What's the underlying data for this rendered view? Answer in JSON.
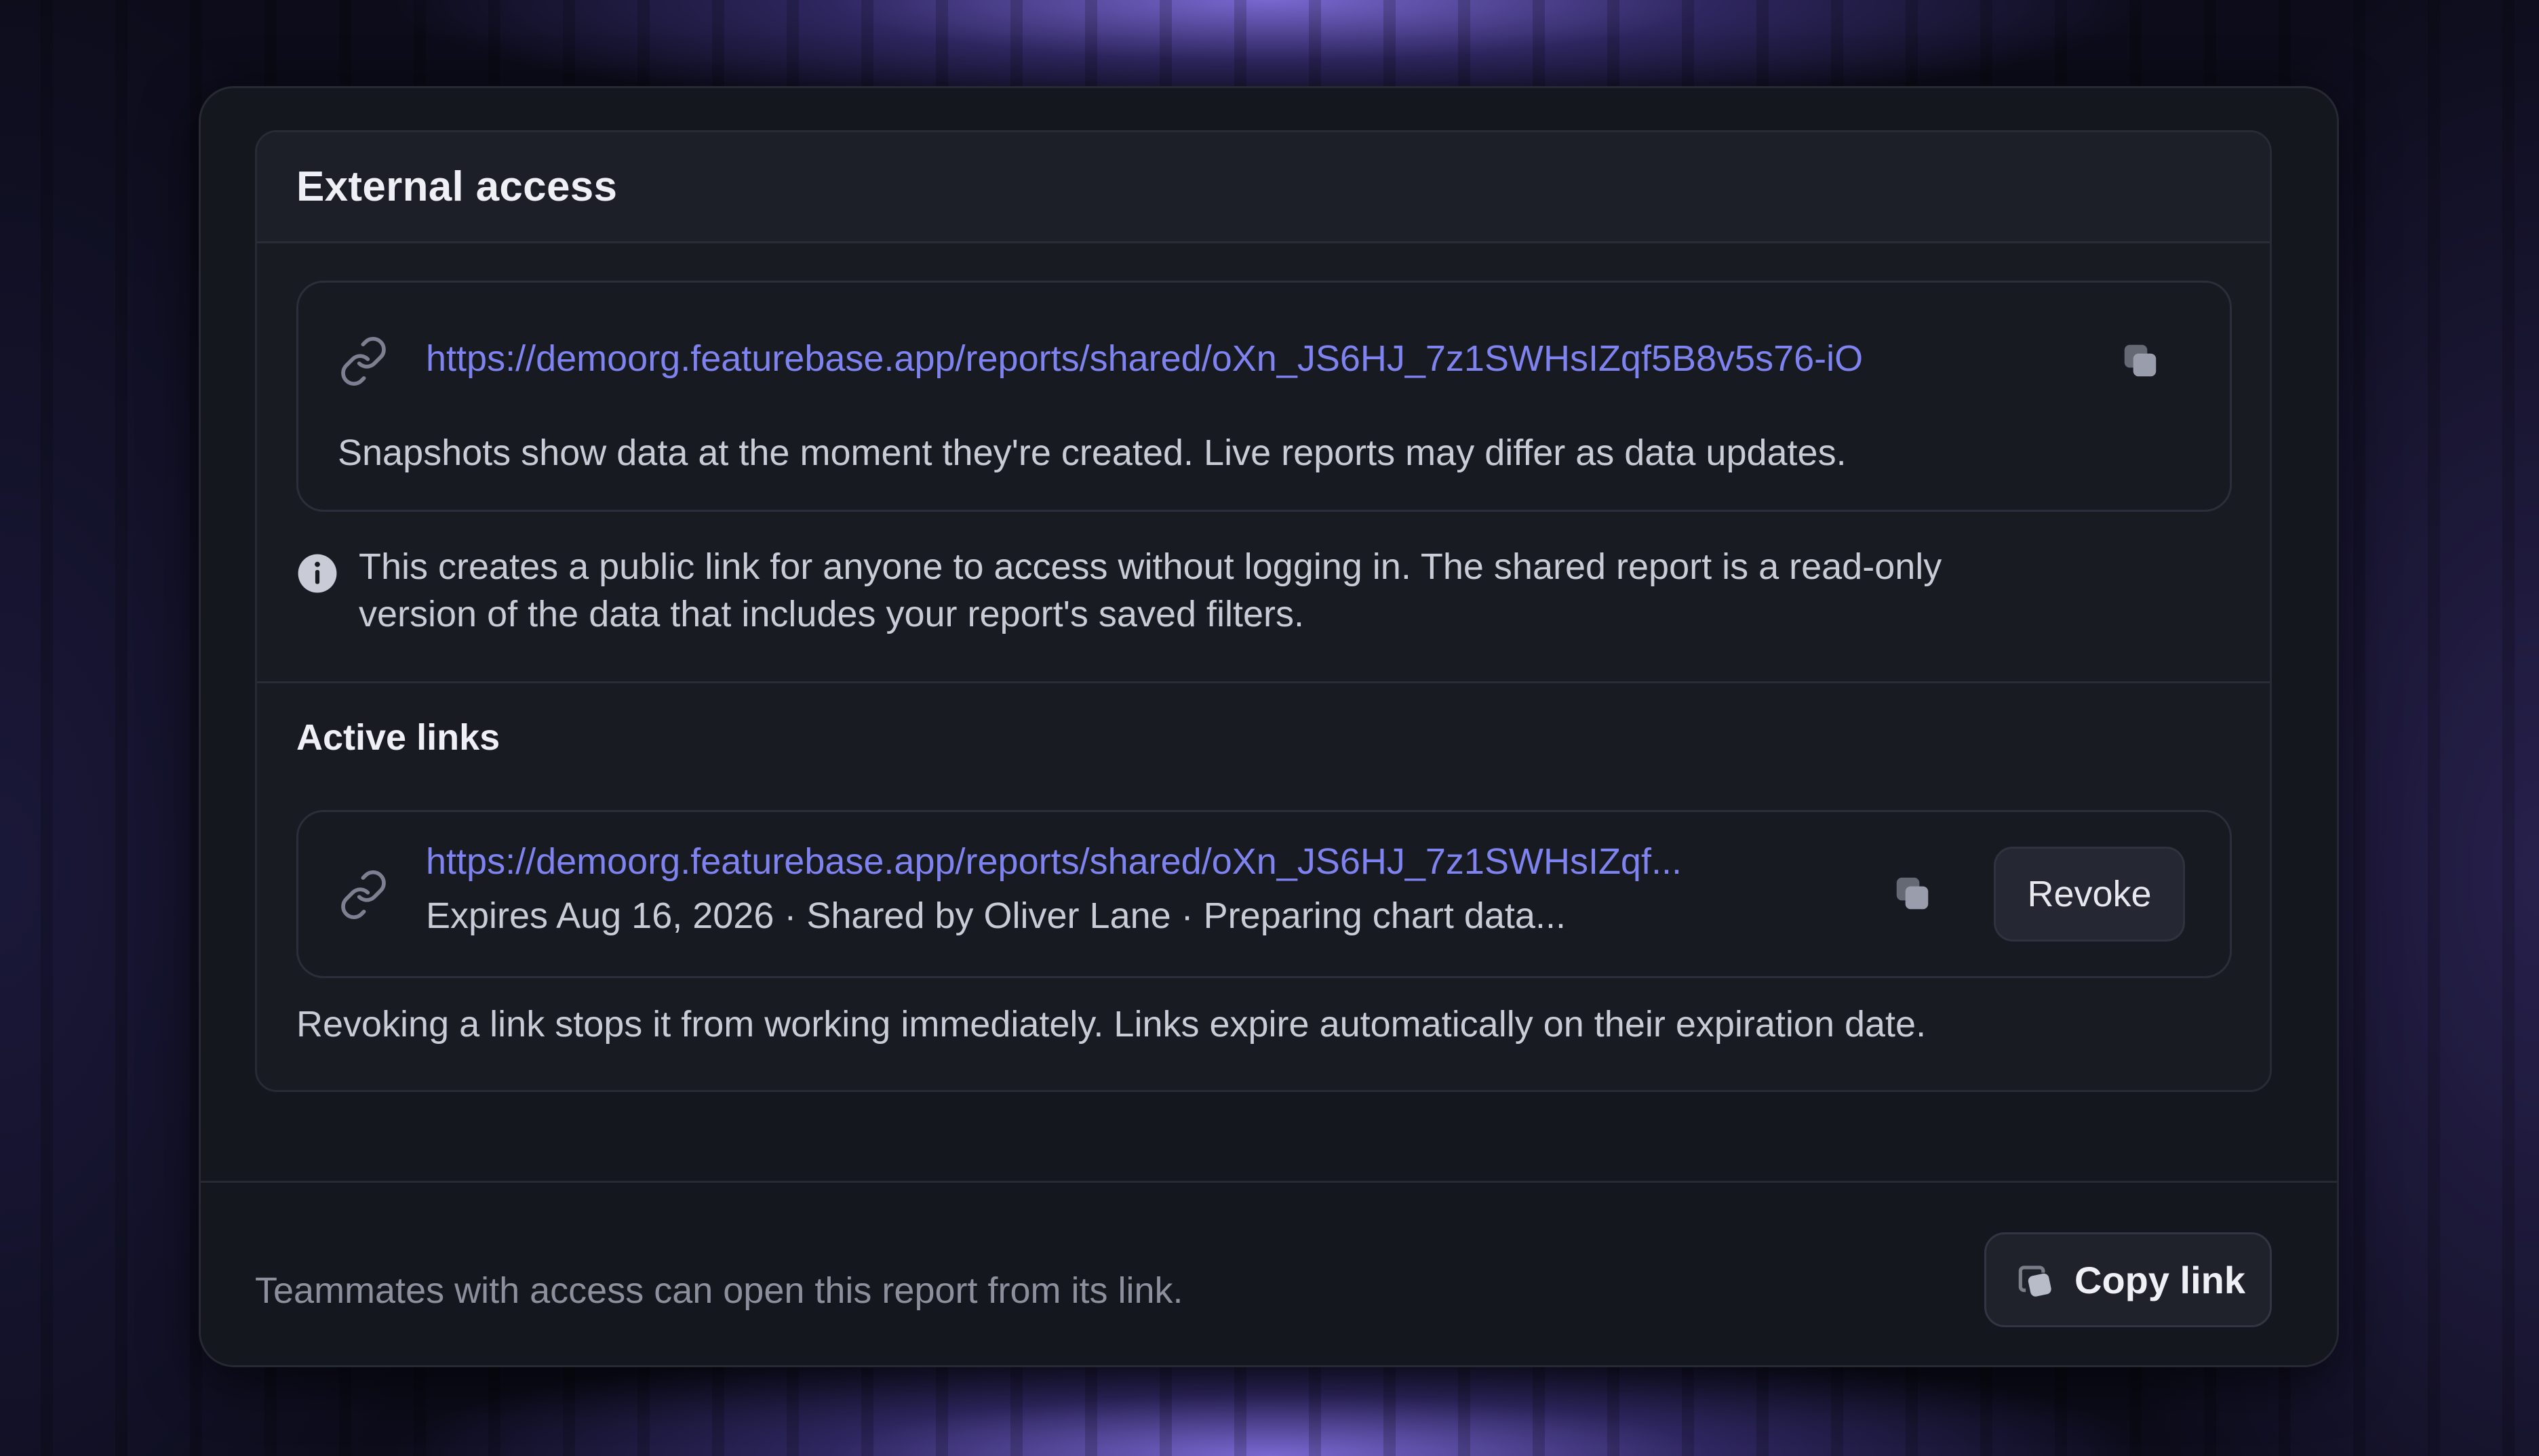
{
  "panel": {
    "title": "External access"
  },
  "snapshot": {
    "url": "https://demoorg.featurebase.app/reports/shared/oXn_JS6HJ_7z1SWHsIZqf5B8v5s76-iO",
    "note": "Snapshots show data at the moment they're created. Live reports may differ as data updates."
  },
  "info": {
    "line1": "This creates a public link for anyone to access without logging in. The shared report is a read-only",
    "line2": "version of the data that includes your report's saved filters."
  },
  "active_links": {
    "title": "Active links",
    "items": [
      {
        "url": "https://demoorg.featurebase.app/reports/shared/oXn_JS6HJ_7z1SWHsIZqf...",
        "meta": "Expires Aug 16, 2026 · Shared by Oliver Lane · Preparing chart data...",
        "revoke_label": "Revoke"
      }
    ],
    "note": "Revoking a link stops it from working immediately. Links expire automatically on their expiration date."
  },
  "footer": {
    "text": "Teammates with access can open this report from its link.",
    "copy_label": "Copy link"
  },
  "colors": {
    "link": "#7f83f0",
    "background": "#0c0c1a",
    "modal": "#15171e"
  }
}
